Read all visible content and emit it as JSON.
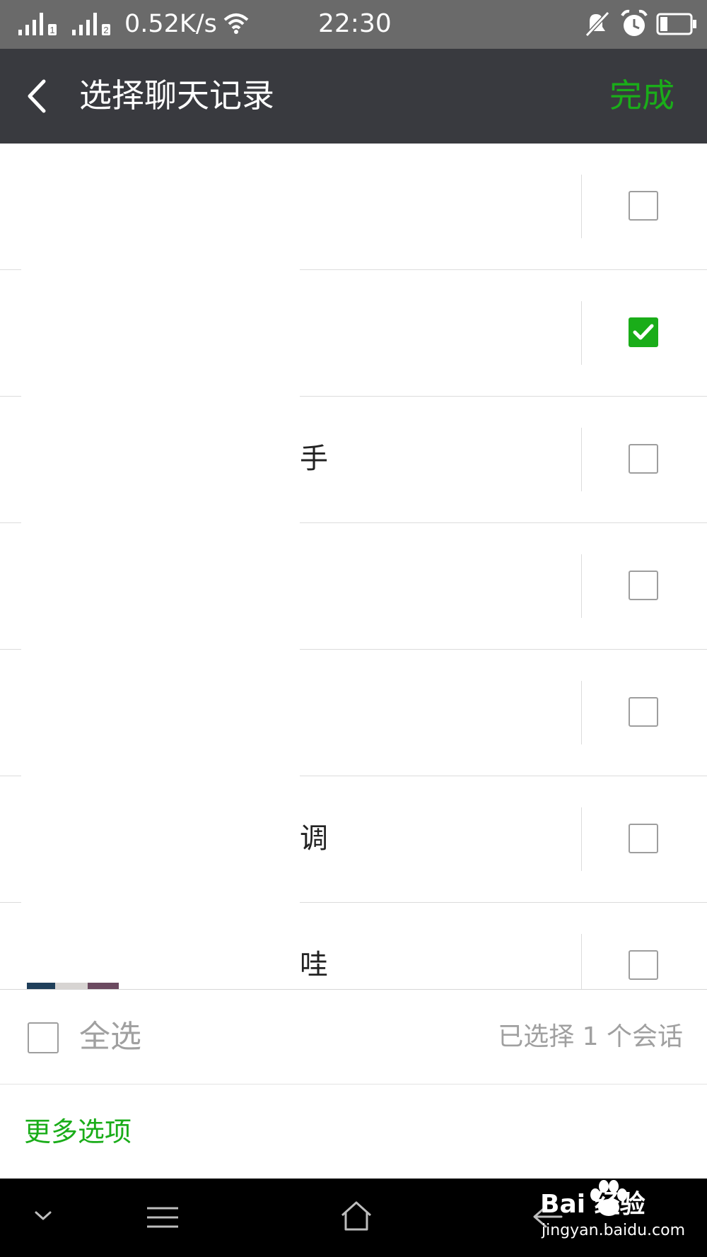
{
  "status_bar": {
    "sim1": "1",
    "sim2": "2",
    "net_speed": "0.52K/s",
    "time": "22:30"
  },
  "header": {
    "title": "选择聊天记录",
    "done": "完成"
  },
  "conversations": [
    {
      "text": "",
      "checked": false
    },
    {
      "text": "",
      "checked": true
    },
    {
      "text": "手",
      "checked": false
    },
    {
      "text": "",
      "checked": false
    },
    {
      "text": "",
      "checked": false
    },
    {
      "text": "调",
      "checked": false
    },
    {
      "text": "哇",
      "checked": false
    }
  ],
  "footer": {
    "select_all": "全选",
    "selected_count": "已选择 1 个会话",
    "more_options": "更多选项"
  },
  "watermark": {
    "main": "Bai  经验",
    "sub": "jingyan.baidu.com"
  },
  "colors": {
    "accent": "#1aad19",
    "header_bg": "#393a3f",
    "status_bg": "#6a6a6a"
  },
  "icons": {
    "back": "chevron-left-icon",
    "checkbox_checked": "check-icon",
    "nav_down": "chevron-down-icon",
    "nav_menu": "menu-icon",
    "nav_home": "home-icon",
    "nav_back": "back-arrow-icon",
    "alarm": "alarm-icon",
    "mute": "mute-icon",
    "wifi": "wifi-icon",
    "battery": "battery-icon"
  }
}
